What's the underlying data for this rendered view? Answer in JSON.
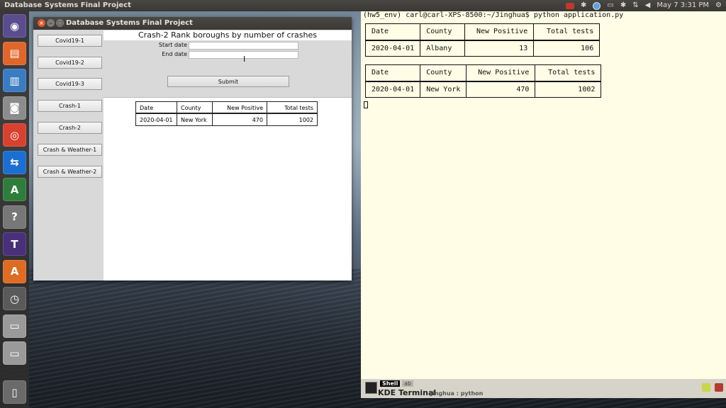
{
  "top_panel": {
    "app_title": "Database Systems Final Project",
    "clock": "May 7  3:31 PM"
  },
  "launcher": {
    "items": [
      {
        "name": "ubuntu-logo-icon",
        "glyph": "◉",
        "color": "#5a4d8f"
      },
      {
        "name": "files-icon",
        "glyph": "▤",
        "color": "#e0662a"
      },
      {
        "name": "document-viewer-icon",
        "glyph": "▥",
        "color": "#3a7cc2"
      },
      {
        "name": "camera-icon",
        "glyph": "◙",
        "color": "#8c8c8c"
      },
      {
        "name": "chrome-icon",
        "glyph": "◎",
        "color": "#d8412f"
      },
      {
        "name": "teamviewer-icon",
        "glyph": "⇆",
        "color": "#1b6fd1"
      },
      {
        "name": "anydesk-icon",
        "glyph": "A",
        "color": "#2f7d3a"
      },
      {
        "name": "help-icon",
        "glyph": "?",
        "color": "#777777"
      },
      {
        "name": "texmaker-icon",
        "glyph": "T",
        "color": "#4a2f7a"
      },
      {
        "name": "software-center-icon",
        "glyph": "A",
        "color": "#e06b22"
      },
      {
        "name": "clock-icon",
        "glyph": "◷",
        "color": "#5a5a5a"
      },
      {
        "name": "drive-icon",
        "glyph": "▭",
        "color": "#9a9a9a"
      },
      {
        "name": "usb-drive-icon",
        "glyph": "▭",
        "color": "#9a9a9a"
      },
      {
        "name": "trash-icon",
        "glyph": "▯",
        "color": "#6a6a6a"
      }
    ]
  },
  "app_window": {
    "title": "Database Systems Final Project",
    "nav_buttons": [
      "Covid19-1",
      "Covid19-2",
      "Covid19-3",
      "Crash-1",
      "Crash-2",
      "Crash & Weather-1",
      "Crash & Weather-2"
    ],
    "form_title": "Crash-2 Rank boroughs by number of crashes",
    "start_label": "Start date",
    "end_label": "End date",
    "start_value": "",
    "end_value": "",
    "submit_label": "Submit",
    "table": {
      "headers": [
        "Date",
        "County",
        "New Positive",
        "Total tests"
      ],
      "rows": [
        [
          "2020-04-01",
          "New York",
          "470",
          "1002"
        ]
      ]
    }
  },
  "terminal": {
    "prompt": "(hw5_env) carl@carl-XPS-8500:~/Jinghua$ python application.py",
    "tables": [
      {
        "headers": [
          "Date",
          "County",
          "New Positive",
          "Total tests"
        ],
        "rows": [
          [
            "2020-04-01",
            "Albany",
            "13",
            "106"
          ]
        ]
      },
      {
        "headers": [
          "Date",
          "County",
          "New Positive",
          "Total tests"
        ],
        "rows": [
          [
            "2020-04-01",
            "New York",
            "470",
            "1002"
          ]
        ]
      }
    ],
    "tab_shell": "Shell",
    "tab_other": "ab",
    "app_name": "KDE Terminal",
    "session": "Jinghua : python"
  }
}
